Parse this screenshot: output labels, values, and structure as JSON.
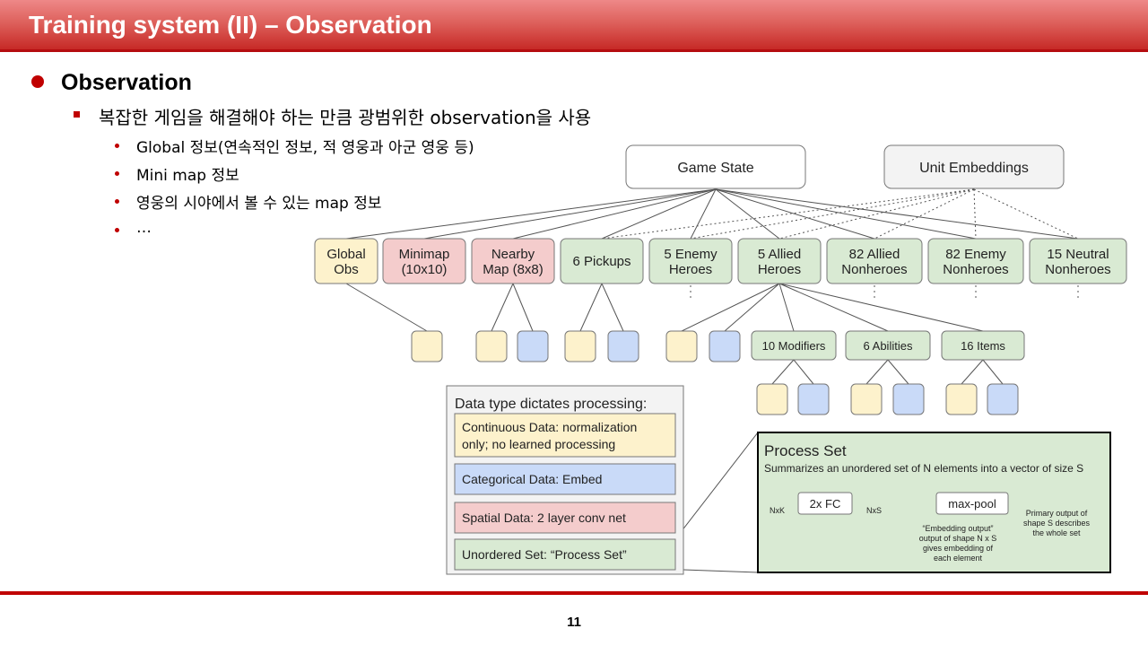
{
  "slide": {
    "title": "Training system (II) – Observation",
    "heading": "Observation",
    "level2": "복잡한 게임을 해결해야 하는 만큼 광범위한 observation을 사용",
    "bullets": [
      "Global 정보(연속적인 정보, 적 영웅과 아군 영웅 등)",
      "Mini map 정보",
      "영웅의 시야에서 볼 수 있는 map 정보",
      "…"
    ],
    "page_number": "11"
  },
  "diagram": {
    "colors": {
      "yellow": "#fdf2cc",
      "blue": "#c9daf8",
      "red": "#f4cccc",
      "green": "#d9ead3",
      "gray": "#f3f3f3",
      "stroke": "#777777"
    },
    "roots": [
      "Game State",
      "Unit Embeddings"
    ],
    "categories": [
      {
        "line1": "Global",
        "line2": "Obs",
        "color": "yellow"
      },
      {
        "line1": "Minimap",
        "line2": "(10x10)",
        "color": "red"
      },
      {
        "line1": "Nearby",
        "line2": "Map (8x8)",
        "color": "red"
      },
      {
        "line1": "6 Pickups",
        "line2": "",
        "color": "green"
      },
      {
        "line1": "5 Enemy",
        "line2": "Heroes",
        "color": "green"
      },
      {
        "line1": "5 Allied",
        "line2": "Heroes",
        "color": "green"
      },
      {
        "line1": "82 Allied",
        "line2": "Nonheroes",
        "color": "green"
      },
      {
        "line1": "82 Enemy",
        "line2": "Nonheroes",
        "color": "green"
      },
      {
        "line1": "15 Neutral",
        "line2": "Nonheroes",
        "color": "green"
      }
    ],
    "sub_sets": [
      "10 Modifiers",
      "6 Abilities",
      "16 Items"
    ],
    "legend": {
      "title": "Data type dictates processing:",
      "items": [
        {
          "line1": "Continuous Data: normalization",
          "line2": "only; no learned processing",
          "color": "yellow"
        },
        {
          "line1": "Categorical Data: Embed",
          "line2": "",
          "color": "blue"
        },
        {
          "line1": "Spatial Data: 2 layer conv net",
          "line2": "",
          "color": "red"
        },
        {
          "line1": "Unordered Set: “Process Set”",
          "line2": "",
          "color": "green"
        }
      ]
    },
    "process_set": {
      "title": "Process Set",
      "subtitle": "Summarizes an unordered set of N elements into a vector of size S",
      "input_label": "NxK",
      "fc_label": "2x FC",
      "mid_label": "NxS",
      "pool_label": "max-pool",
      "embedding_note": [
        "“Embedding output”",
        "output of shape N x S",
        "gives embedding of",
        "each element"
      ],
      "primary_note": [
        "Primary output of",
        "shape S describes",
        "the whole set"
      ]
    }
  }
}
